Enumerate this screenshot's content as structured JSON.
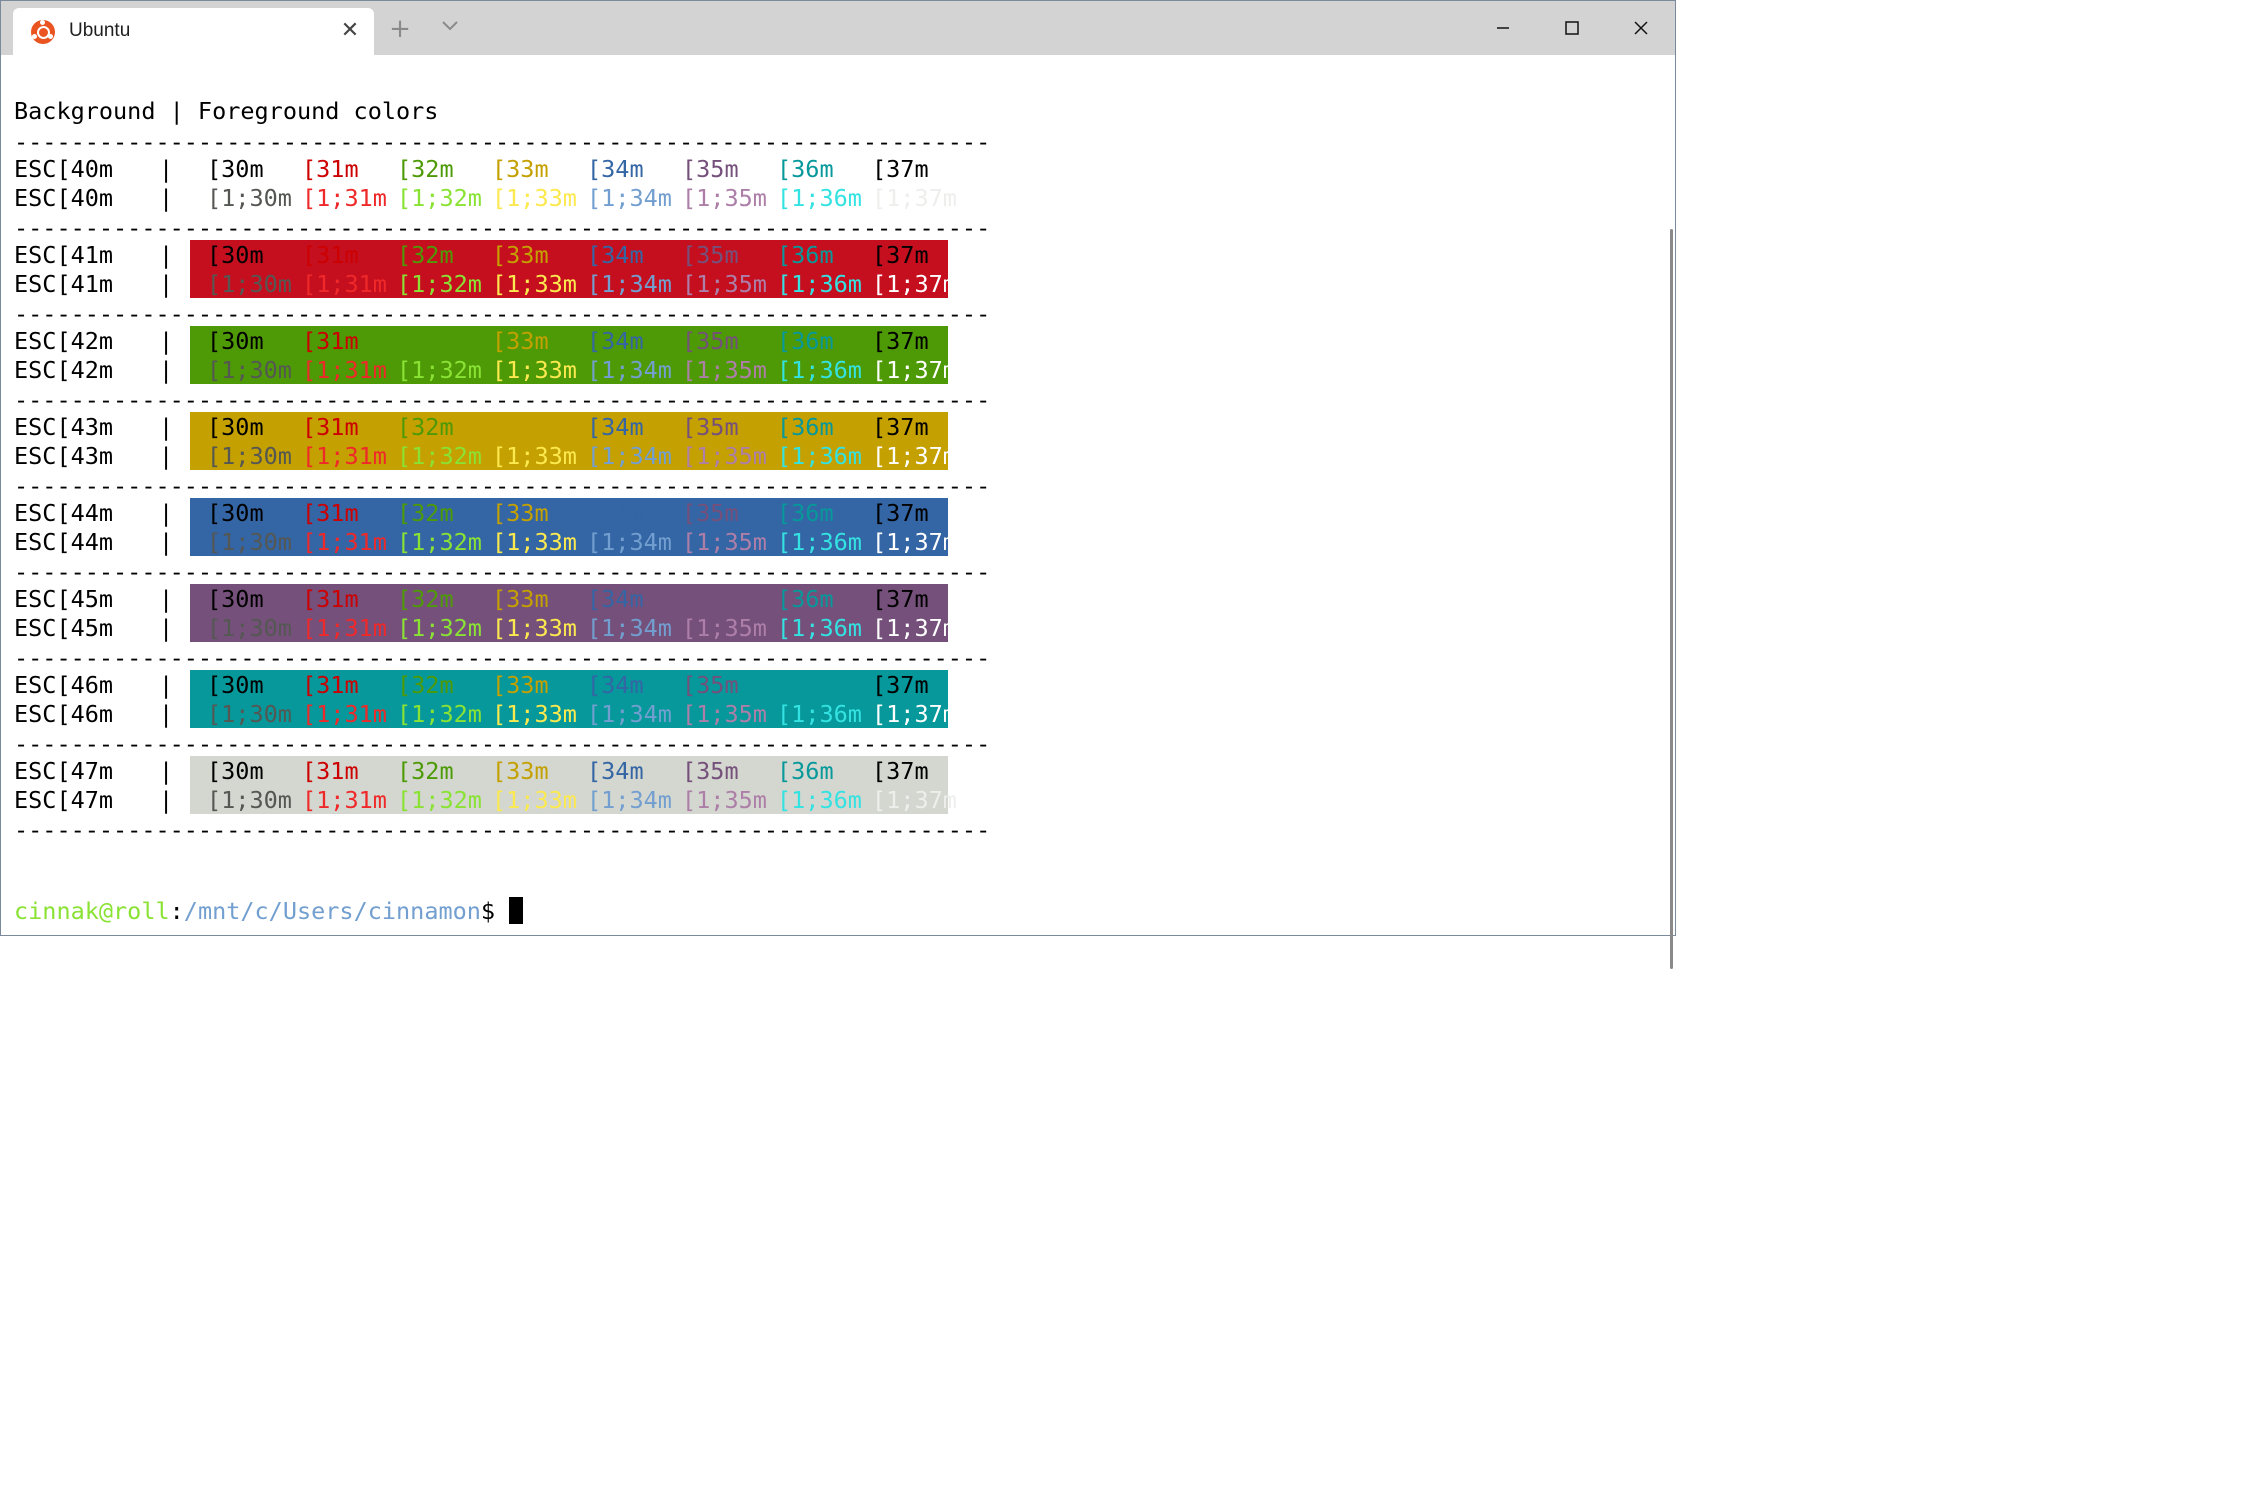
{
  "tab": {
    "title": "Ubuntu",
    "icon": "ubuntu-logo-icon",
    "close_symbol": "✕"
  },
  "tab_actions": {
    "new_tab_symbol": "+",
    "dropdown_icon": "chevron-down-icon"
  },
  "window_controls": {
    "minimize_icon": "minimize-icon",
    "maximize_icon": "maximize-icon",
    "close_icon": "close-icon"
  },
  "terminal": {
    "header": "Background | Foreground colors",
    "separator": "---------------------------------------------------------------------",
    "pipe": "|",
    "rows": [
      {
        "bg_label": "ESC[40m",
        "bg": null,
        "normal_label": "ESC[40m",
        "bold_label": "ESC[40m"
      },
      {
        "bg_label": "ESC[41m",
        "bg": "#c50f1f",
        "normal_label": "ESC[41m",
        "bold_label": "ESC[41m"
      },
      {
        "bg_label": "ESC[42m",
        "bg": "#4e9a06",
        "normal_label": "ESC[42m",
        "bold_label": "ESC[42m"
      },
      {
        "bg_label": "ESC[43m",
        "bg": "#c4a000",
        "normal_label": "ESC[43m",
        "bold_label": "ESC[43m"
      },
      {
        "bg_label": "ESC[44m",
        "bg": "#3465a4",
        "normal_label": "ESC[44m",
        "bold_label": "ESC[44m"
      },
      {
        "bg_label": "ESC[45m",
        "bg": "#75507b",
        "normal_label": "ESC[45m",
        "bold_label": "ESC[45m"
      },
      {
        "bg_label": "ESC[46m",
        "bg": "#06989a",
        "normal_label": "ESC[46m",
        "bold_label": "ESC[46m"
      },
      {
        "bg_label": "ESC[47m",
        "bg": "#d3d7cf",
        "normal_label": "ESC[47m",
        "bold_label": "ESC[47m"
      }
    ],
    "fg_normal": [
      {
        "code": "[30m",
        "color": "#000000"
      },
      {
        "code": "[31m",
        "color": "#cc0000"
      },
      {
        "code": "[32m",
        "color": "#4e9a06"
      },
      {
        "code": "[33m",
        "color": "#c4a000"
      },
      {
        "code": "[34m",
        "color": "#3465a4"
      },
      {
        "code": "[35m",
        "color": "#75507b"
      },
      {
        "code": "[36m",
        "color": "#06989a"
      },
      {
        "code": "[37m",
        "color": "#000000"
      }
    ],
    "fg_bold": [
      {
        "code": "[1;30m",
        "color": "#555753"
      },
      {
        "code": "[1;31m",
        "color": "#ef2929"
      },
      {
        "code": "[1;32m",
        "color": "#8ae234"
      },
      {
        "code": "[1;33m",
        "color": "#fce94f"
      },
      {
        "code": "[1;34m",
        "color": "#729fcf"
      },
      {
        "code": "[1;35m",
        "color": "#ad7fa8"
      },
      {
        "code": "[1;36m",
        "color": "#34e2e2"
      },
      {
        "code": "[1;37m",
        "color": "#eeeeec"
      }
    ],
    "row37_on_bg_color": "#000000",
    "bold37_on_bg_color": "#ffffff",
    "prompt": {
      "user_host": "cinnak@roll",
      "colon": ":",
      "path": "/mnt/c/Users/cinnamon",
      "symbol": "$"
    },
    "colors": {
      "user_host": "#8ae234",
      "path": "#729fcf"
    }
  }
}
